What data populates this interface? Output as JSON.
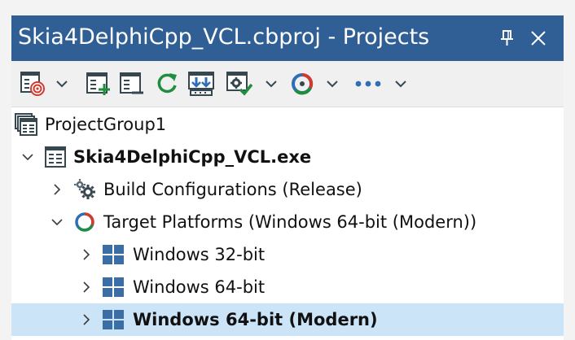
{
  "window": {
    "title": "Skia4DelphiCpp_VCL.cbproj - Projects",
    "title_bg": "#2f5f95",
    "pin_icon": "pin-icon",
    "close_icon": "close-icon"
  },
  "toolbar": {
    "buttons": [
      {
        "name": "build-target-icon",
        "has_dropdown": true
      },
      {
        "name": "add-new-project-icon",
        "has_dropdown": false
      },
      {
        "name": "remove-project-icon",
        "has_dropdown": false
      },
      {
        "name": "refresh-icon",
        "has_dropdown": false
      },
      {
        "name": "deploy-icon",
        "has_dropdown": false
      },
      {
        "name": "build-config-check-icon",
        "has_dropdown": true
      },
      {
        "name": "target-platform-icon",
        "has_dropdown": true
      },
      {
        "name": "more-icon",
        "has_dropdown": true
      }
    ]
  },
  "tree": {
    "selected_bg": "#cce4f7",
    "items": [
      {
        "label": "ProjectGroup1",
        "icon": "project-group-icon",
        "bold": false,
        "expander": "none",
        "indent": 0
      },
      {
        "label": "Skia4DelphiCpp_VCL.exe",
        "icon": "project-icon",
        "bold": true,
        "expander": "expanded",
        "indent": 1
      },
      {
        "label": "Build Configurations (Release)",
        "icon": "gear-icon",
        "bold": false,
        "expander": "collapsed",
        "indent": 2
      },
      {
        "label": "Target Platforms (Windows 64-bit (Modern))",
        "icon": "target-platforms-icon",
        "bold": false,
        "expander": "expanded",
        "indent": 2
      },
      {
        "label": "Windows 32-bit",
        "icon": "windows-icon",
        "bold": false,
        "expander": "collapsed",
        "indent": 3
      },
      {
        "label": "Windows 64-bit",
        "icon": "windows-icon",
        "bold": false,
        "expander": "collapsed",
        "indent": 3
      },
      {
        "label": "Windows 64-bit (Modern)",
        "icon": "windows-icon",
        "bold": true,
        "expander": "collapsed",
        "indent": 3,
        "selected": true
      }
    ]
  }
}
